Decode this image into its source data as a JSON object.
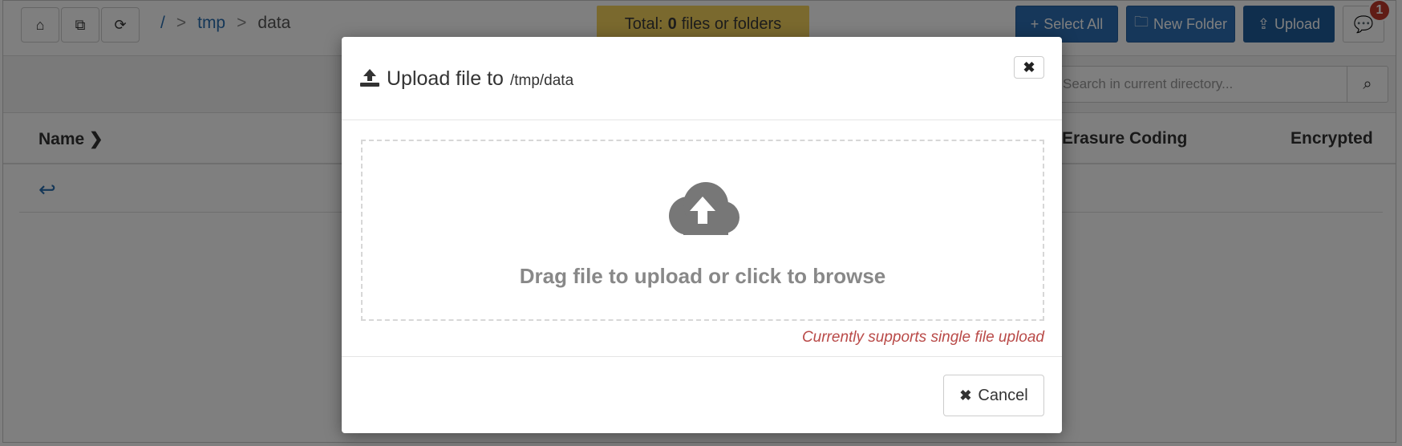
{
  "toolbar": {
    "home_icon": "home-icon",
    "copy_icon": "copy-icon",
    "refresh_icon": "refresh-icon",
    "breadcrumb": {
      "root": "/",
      "sep": ">",
      "folder": "tmp",
      "current": "data"
    },
    "total_prefix": "Total:",
    "total_count": "0",
    "total_suffix": "files or folders",
    "select_all_label": "Select All",
    "new_folder_label": "New Folder",
    "upload_label": "Upload",
    "notification_count": "1"
  },
  "search": {
    "placeholder": "Search in current directory..."
  },
  "table": {
    "columns": {
      "name": "Name",
      "erasure": "Erasure Coding",
      "encrypted": "Encrypted"
    },
    "name_sort_glyph": "❯"
  },
  "modal": {
    "title": "Upload file to",
    "path": "/tmp/data",
    "close_glyph": "✖",
    "drop_text": "Drag file to upload or click to browse",
    "note": "Currently supports single file upload",
    "cancel_label": "Cancel",
    "cancel_glyph": "✖"
  },
  "colors": {
    "primary": "#2c6fb5",
    "total_bg": "#f4d35c",
    "note": "#b94a48",
    "badge": "#c0392b"
  }
}
